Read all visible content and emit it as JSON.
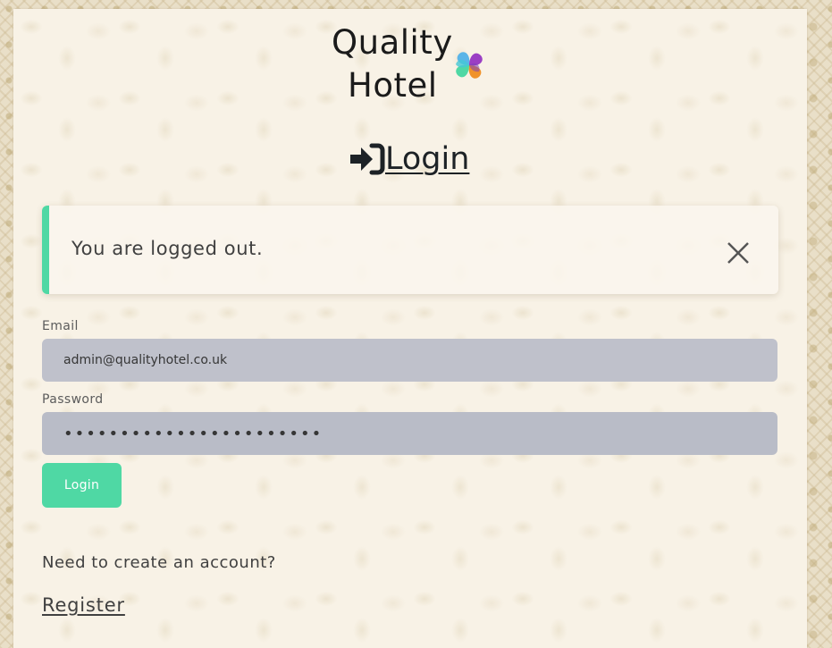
{
  "brand": {
    "line1": "Quality",
    "line2": "Hotel",
    "logo_icon": "pinwheel-logo",
    "logo_colors": [
      "#4fd8a4",
      "#5bb5e8",
      "#9b3fc4",
      "#f0922a"
    ]
  },
  "heading": {
    "icon": "sign-in-icon",
    "text": "Login"
  },
  "alert": {
    "message": "You are logged out.",
    "close_icon": "close-icon",
    "accent_color": "#4fd8a4"
  },
  "form": {
    "email_label": "Email",
    "email_value": "admin@qualityhotel.co.uk",
    "password_label": "Password",
    "password_value": "•••••••••••••••••••••••",
    "submit_label": "Login"
  },
  "footer": {
    "prompt": "Need to create an account?",
    "register_label": "Register"
  },
  "colors": {
    "accent": "#4fd8a4",
    "input_bg": "#bfc1cb"
  }
}
